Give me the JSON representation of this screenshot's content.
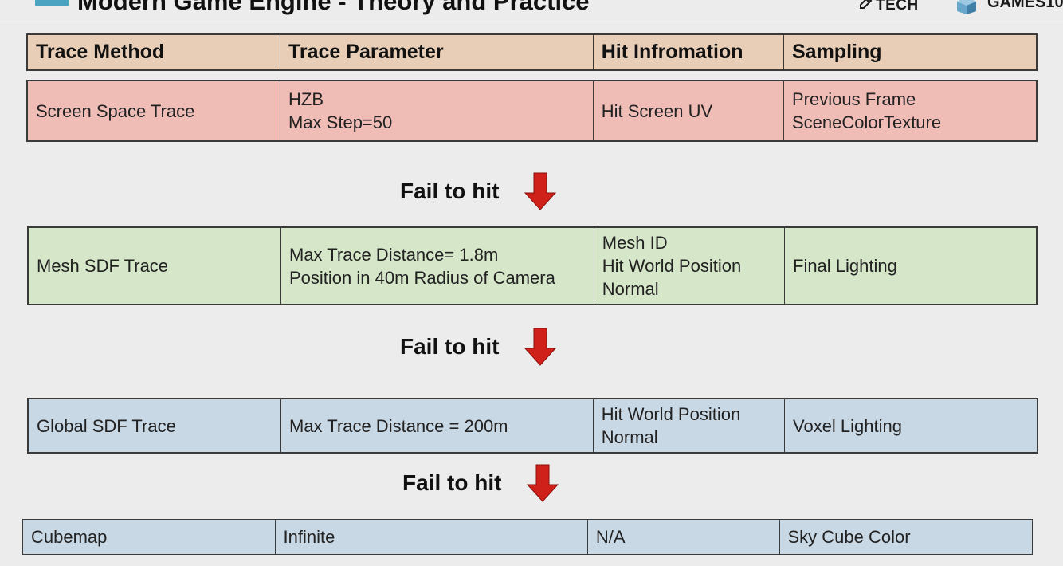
{
  "header": {
    "title": "Modern Game Engine - Theory and Practice",
    "brand_tech": "TECH",
    "brand_games": "GAMES10"
  },
  "table_header": [
    "Trace Method",
    "Trace Parameter",
    "Hit Infromation",
    "Sampling"
  ],
  "rows": [
    {
      "method": "Screen Space Trace",
      "parameter": [
        "HZB",
        "Max Step=50"
      ],
      "hit": [
        "Hit Screen UV"
      ],
      "sampling": [
        "Previous Frame",
        "SceneColorTexture"
      ]
    },
    {
      "method": "Mesh SDF Trace",
      "parameter": [
        "Max Trace Distance= 1.8m",
        "Position in 40m Radius of Camera"
      ],
      "hit": [
        "Mesh ID",
        "Hit World Position",
        "Normal"
      ],
      "sampling": [
        "Final Lighting"
      ]
    },
    {
      "method": "Global SDF Trace",
      "parameter": [
        "Max Trace Distance = 200m"
      ],
      "hit": [
        "Hit World Position",
        "Normal"
      ],
      "sampling": [
        "Voxel Lighting"
      ]
    },
    {
      "method": "Cubemap",
      "parameter": [
        "Infinite"
      ],
      "hit": [
        "N/A"
      ],
      "sampling": [
        "Sky Cube Color"
      ]
    }
  ],
  "fail_labels": [
    "Fail to hit",
    "Fail to hit",
    "Fail to hit"
  ],
  "colors": {
    "header_row": "#e8cdb7",
    "screen_space_row": "#f0bcb6",
    "mesh_sdf_row": "#d5e6c9",
    "global_sdf_row": "#c9d8e5",
    "arrow": "#d0201a"
  },
  "icons": [
    "logo-square-icon",
    "pen-icon",
    "cube-logo-icon",
    "down-arrow-icon"
  ]
}
